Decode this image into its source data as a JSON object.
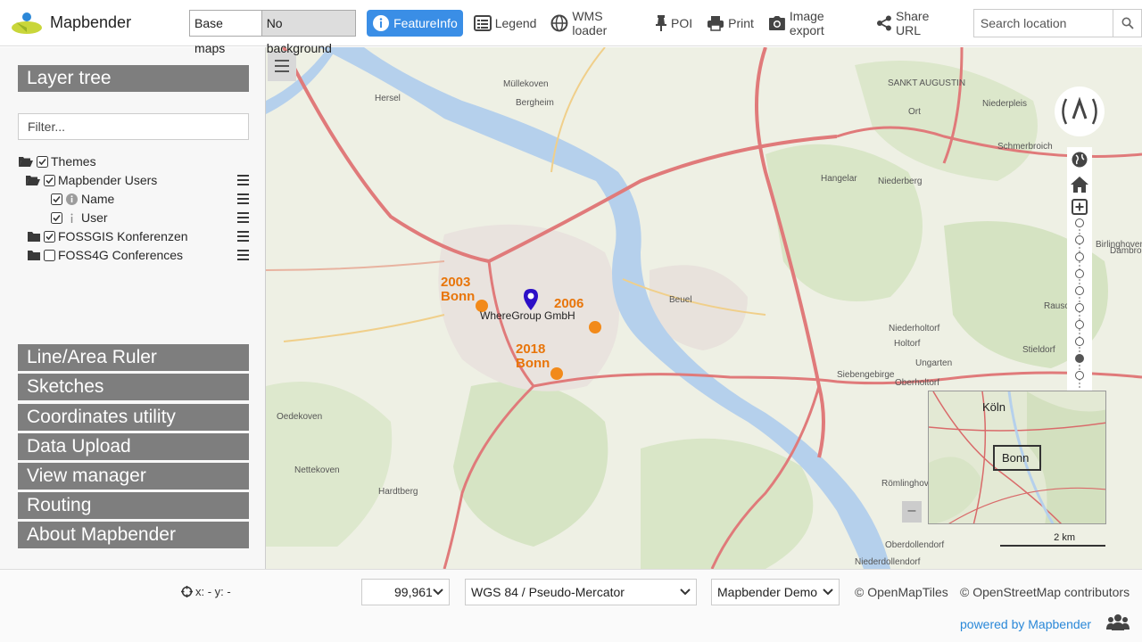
{
  "header": {
    "brand": "Mapbender",
    "basemaps": {
      "base_label": "Base maps",
      "nobg_label": "No background"
    },
    "tools": {
      "featureinfo": "FeatureInfo",
      "legend": "Legend",
      "wms_loader": "WMS loader",
      "poi": "POI",
      "print": "Print",
      "image_export": "Image export",
      "share_url": "Share URL"
    },
    "search": {
      "placeholder": "Search location"
    }
  },
  "sidebar": {
    "layer_tree_title": "Layer tree",
    "filter_placeholder": "Filter...",
    "tree": {
      "themes": "Themes",
      "users": "Mapbender Users",
      "name": "Name",
      "user": "User",
      "fossgis": "FOSSGIS Konferenzen",
      "foss4g": "FOSS4G Conferences"
    },
    "accordion": [
      "Line/Area Ruler",
      "Sketches",
      "Coordinates utility",
      "Data Upload",
      "View manager",
      "Routing",
      "About Mapbender"
    ]
  },
  "map": {
    "places": {
      "herse": "Hersel",
      "mullekoven": "Müllekoven",
      "bergheim": "Bergheim",
      "sankt": "SANKT AUGUSTIN",
      "niederpleis": "Niederpleis",
      "ort": "Ort",
      "schmerbroich": "Schmerbroich",
      "hangelar": "Hangelar",
      "niederberg": "Niederberg",
      "birlinghoven": "Birlinghoven",
      "dambroich": "Dambroich",
      "beuel": "Beuel",
      "niederholtorf": "Niederholtorf",
      "holtorf": "Holtorf",
      "stieldorf": "Stieldorf",
      "ungarten": "Ungarten",
      "oberholtorf": "Oberholtorf",
      "oedekoven": "Oedekoven",
      "nettekoven": "Nettekoven",
      "hardtberg": "Hardtberg",
      "romlinghoven": "Römlinghoven",
      "oberdollendorf": "Oberdollendorf",
      "niederdollendorf": "Niederdollendorf",
      "siebengebirge": "Siebengebirge",
      "rausche": "Rausche"
    },
    "pois": {
      "p2003": "2003\nBonn",
      "p2006": "2006",
      "p2018": "2018\nBonn",
      "wheregroup": "WhereGroup GmbH"
    },
    "overview": {
      "koln": "Köln",
      "bonn": "Bonn"
    },
    "scale_text": "2 km",
    "minimize": "–"
  },
  "footer": {
    "coords": "x: - y: -",
    "scale": "99,961",
    "srs": "WGS 84 / Pseudo-Mercator",
    "app": "Mapbender Demo",
    "attrib1": "© OpenMapTiles",
    "attrib2": "© OpenStreetMap contributors",
    "powered": "powered by Mapbender"
  },
  "colors": {
    "accent": "#3a8ee6",
    "panel": "#7a7a7a",
    "poi": "#f28a1a",
    "marker": "#2c0fc7",
    "river": "#b5d0ec",
    "road": "#e07a7a"
  }
}
